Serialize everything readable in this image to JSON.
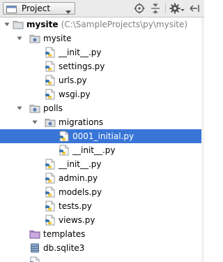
{
  "toolbar": {
    "view_label": "Project",
    "icons": [
      "project-view-icon",
      "dropdown-arrow-icon",
      "scroll-from-source-icon",
      "collapse-all-icon",
      "settings-gear-icon",
      "hide-panel-icon"
    ]
  },
  "tree": {
    "root": {
      "name": "mysite",
      "path": "(C:\\SampleProjects\\py\\mysite)"
    },
    "items": [
      {
        "label": "mysite"
      },
      {
        "label": "__init__.py"
      },
      {
        "label": "settings.py"
      },
      {
        "label": "urls.py"
      },
      {
        "label": "wsgi.py"
      },
      {
        "label": "polls"
      },
      {
        "label": "migrations"
      },
      {
        "label": "0001_initial.py"
      },
      {
        "label": "__init__.py"
      },
      {
        "label": "__init__.py"
      },
      {
        "label": "admin.py"
      },
      {
        "label": "models.py"
      },
      {
        "label": "tests.py"
      },
      {
        "label": "views.py"
      },
      {
        "label": "templates"
      },
      {
        "label": "db.sqlite3"
      }
    ]
  },
  "colors": {
    "selection": "#3875d7",
    "toolbar_bg": "#ebebeb",
    "folder": "#b4b6b9",
    "package_dot": "#5a7bb5",
    "python_blue": "#3c78aa",
    "python_yellow": "#f5c93a",
    "templates_folder": "#a97ac9"
  }
}
